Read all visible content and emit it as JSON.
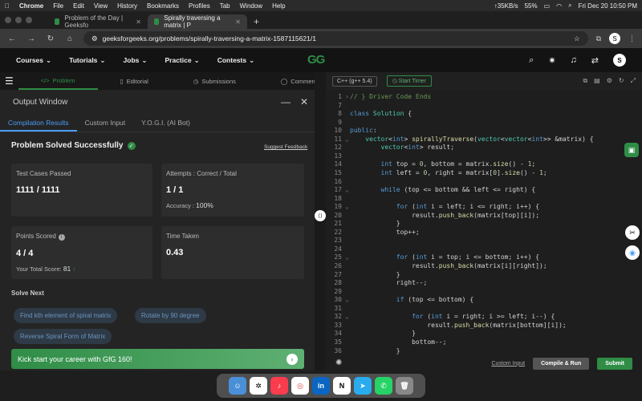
{
  "menubar": {
    "app": "Chrome",
    "items": [
      "File",
      "Edit",
      "View",
      "History",
      "Bookmarks",
      "Profiles",
      "Tab",
      "Window",
      "Help"
    ],
    "network": "↑35KB/s",
    "battery": "55%",
    "datetime": "Fri Dec 20  10:50 PM"
  },
  "tabs": [
    {
      "title": "Problem of the Day | Geeksfo"
    },
    {
      "title": "Spirally traversing a matrix | P"
    }
  ],
  "address": {
    "url": "geeksforgeeks.org/problems/spirally-traversing-a-matrix-1587115621/1",
    "profile": "S"
  },
  "gfg": {
    "nav": [
      "Courses",
      "Tutorials",
      "Jobs",
      "Practice",
      "Contests"
    ],
    "logo": "GG",
    "user_initial": "S"
  },
  "left_tabs": [
    "Problem",
    "Editorial",
    "Submissions",
    "Comments"
  ],
  "output": {
    "title": "Output Window",
    "tabs": [
      "Compilation Results",
      "Custom Input",
      "Y.O.G.I. (AI Bot)"
    ],
    "status": "Problem Solved Successfully",
    "suggest": "Suggest Feedback",
    "test_label": "Test Cases Passed",
    "test_value": "1111 / 1111",
    "attempts_label": "Attempts : Correct / Total",
    "attempts_value": "1 / 1",
    "accuracy_label": "Accuracy :",
    "accuracy_value": "100%",
    "points_label": "Points Scored",
    "points_value": "4 / 4",
    "total_label": "Your Total Score:",
    "total_value": "81",
    "time_label": "Time Taken",
    "time_value": "0.43",
    "solve_next": "Solve Next",
    "chips": [
      "Find kth element of spiral matrix",
      "Rotate by 90 degree",
      "Reverse Spiral Form of Matrix"
    ],
    "banner": "Kick start your career with GfG 160!"
  },
  "editor": {
    "language": "C++ (g++ 5.4)",
    "timer": "Start Timer",
    "custom_input": "Custom Input",
    "run": "Compile & Run",
    "submit": "Submit",
    "lines": [
      {
        "n": "1",
        "arrow": "›",
        "html": "<span class='cm'>// } Driver Code Ends</span>"
      },
      {
        "n": "7",
        "arrow": "",
        "html": ""
      },
      {
        "n": "8",
        "arrow": "",
        "html": "<span class='kw'>class</span> <span class='ty'>Solution</span> <span class='tx'>{</span>"
      },
      {
        "n": "9",
        "arrow": "",
        "html": ""
      },
      {
        "n": "10",
        "arrow": "",
        "html": "<span class='kw'>public</span><span class='tx'>:</span>"
      },
      {
        "n": "11",
        "arrow": "⌄",
        "html": "    <span class='ty'>vector</span><span class='tx'>&lt;</span><span class='kw'>int</span><span class='tx'>&gt; </span><span class='fn'>spirallyTraverse</span><span class='tx'>(</span><span class='ty'>vector</span><span class='tx'>&lt;</span><span class='ty'>vector</span><span class='tx'>&lt;</span><span class='kw'>int</span><span class='tx'>&gt;&gt; &amp;matrix) {</span>"
      },
      {
        "n": "12",
        "arrow": "",
        "html": "        <span class='ty'>vector</span><span class='tx'>&lt;</span><span class='kw'>int</span><span class='tx'>&gt; result;</span>"
      },
      {
        "n": "13",
        "arrow": "",
        "html": ""
      },
      {
        "n": "14",
        "arrow": "",
        "html": "        <span class='kw'>int</span><span class='tx'> top = </span><span class='nm'>0</span><span class='tx'>, bottom = matrix.</span><span class='fn'>size</span><span class='tx'>() - </span><span class='nm'>1</span><span class='tx'>;</span>"
      },
      {
        "n": "15",
        "arrow": "",
        "html": "        <span class='kw'>int</span><span class='tx'> left = </span><span class='nm'>0</span><span class='tx'>, right = matrix[</span><span class='nm'>0</span><span class='tx'>].</span><span class='fn'>size</span><span class='tx'>() - </span><span class='nm'>1</span><span class='tx'>;</span>"
      },
      {
        "n": "16",
        "arrow": "",
        "html": ""
      },
      {
        "n": "17",
        "arrow": "⌄",
        "html": "        <span class='kw'>while</span><span class='tx'> (top &lt;= bottom &amp;&amp; left &lt;= right) {</span>"
      },
      {
        "n": "18",
        "arrow": "",
        "html": ""
      },
      {
        "n": "19",
        "arrow": "⌄",
        "html": "            <span class='kw'>for</span><span class='tx'> (</span><span class='kw'>int</span><span class='tx'> i = left; i &lt;= right; i++) {</span>"
      },
      {
        "n": "20",
        "arrow": "",
        "html": "                <span class='tx'>result.</span><span class='fn'>push_back</span><span class='tx'>(matrix[top][i]);</span>"
      },
      {
        "n": "21",
        "arrow": "",
        "html": "            <span class='tx'>}</span>"
      },
      {
        "n": "22",
        "arrow": "",
        "html": "            <span class='tx'>top++;</span>"
      },
      {
        "n": "23",
        "arrow": "",
        "html": ""
      },
      {
        "n": "24",
        "arrow": "",
        "html": ""
      },
      {
        "n": "25",
        "arrow": "⌄",
        "html": "            <span class='kw'>for</span><span class='tx'> (</span><span class='kw'>int</span><span class='tx'> i = top; i &lt;= bottom; i++) {</span>"
      },
      {
        "n": "26",
        "arrow": "",
        "html": "                <span class='tx'>result.</span><span class='fn'>push_back</span><span class='tx'>(matrix[i][right]);</span>"
      },
      {
        "n": "27",
        "arrow": "",
        "html": "            <span class='tx'>}</span>"
      },
      {
        "n": "28",
        "arrow": "",
        "html": "            <span class='tx'>right--;</span>"
      },
      {
        "n": "29",
        "arrow": "",
        "html": ""
      },
      {
        "n": "30",
        "arrow": "⌄",
        "html": "            <span class='kw'>if</span><span class='tx'> (top &lt;= bottom) {</span>"
      },
      {
        "n": "31",
        "arrow": "",
        "html": ""
      },
      {
        "n": "32",
        "arrow": "⌄",
        "html": "                <span class='kw'>for</span><span class='tx'> (</span><span class='kw'>int</span><span class='tx'> i = right; i &gt;= left; i--) {</span>"
      },
      {
        "n": "33",
        "arrow": "",
        "html": "                    <span class='tx'>result.</span><span class='fn'>push_back</span><span class='tx'>(matrix[bottom][i]);</span>"
      },
      {
        "n": "34",
        "arrow": "",
        "html": "                <span class='tx'>}</span>"
      },
      {
        "n": "35",
        "arrow": "",
        "html": "                <span class='tx'>bottom--;</span>"
      },
      {
        "n": "36",
        "arrow": "",
        "html": "            <span class='tx'>}</span>"
      }
    ]
  },
  "colors": {
    "brand_green": "#2f8d46",
    "link_blue": "#4a9df5",
    "chip_text": "#6c93bf"
  },
  "dock": [
    "finder-icon",
    "chatgpt-icon",
    "music-icon",
    "chrome-icon",
    "linkedin-icon",
    "notion-icon",
    "telegram-icon",
    "whatsapp-icon",
    "trash-icon"
  ]
}
